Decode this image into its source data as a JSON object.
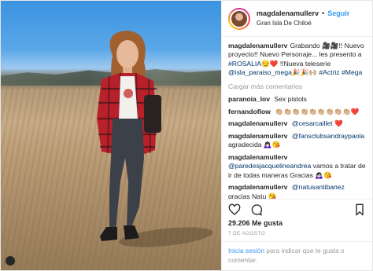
{
  "header": {
    "username": "magdalenamullerv",
    "separator": "•",
    "follow_label": "Seguir",
    "location": "Gran Isla De Chiloé"
  },
  "caption": {
    "username": "magdalenamullerv",
    "text_1": "Grabando 🎥🎥!! Nuevo proyecto!! Nuevo Personaje... les presento a",
    "tag_rosalia": "#ROSALIA",
    "text_2": "😏❤️ !!Nueva teleserie",
    "mention": "@isla_paraiso_mega",
    "text_3": "🎉🎉🙌🏼",
    "tag_actriz": "#Actriz",
    "tag_mega": "#Mega"
  },
  "load_more_label": "Cargar más comentarios",
  "comments": [
    {
      "username": "paranoia_lov",
      "text": "Sex pistols"
    },
    {
      "username": "fernandoflow",
      "text": "👏🏼👏🏼👏🏼👏🏼👏🏼👏🏼👏🏼👏🏼👏🏼❤️"
    },
    {
      "username": "magdalenamullerv",
      "mention": "@cesarcaillet",
      "text": "❤️"
    },
    {
      "username": "magdalenamullerv",
      "mention": "@fansclubsandraypaola",
      "text": "agradecida 🙇🏻‍♀️😘"
    },
    {
      "username": "magdalenamullerv",
      "mention": "@paredesjacquelineandrea",
      "text": "vamos a tratar de ir de todas maneras Gracias 🙇🏻‍♀️😘"
    },
    {
      "username": "magdalenamullerv",
      "mention": "@natusantibanez",
      "text": "gracias Natu 😘"
    }
  ],
  "likes_label": "29.206 Me gusta",
  "date_label": "7 DE AGOSTO",
  "login": {
    "link_label": "Inicia sesión",
    "text": "para indicar que te gusta o comentar."
  }
}
